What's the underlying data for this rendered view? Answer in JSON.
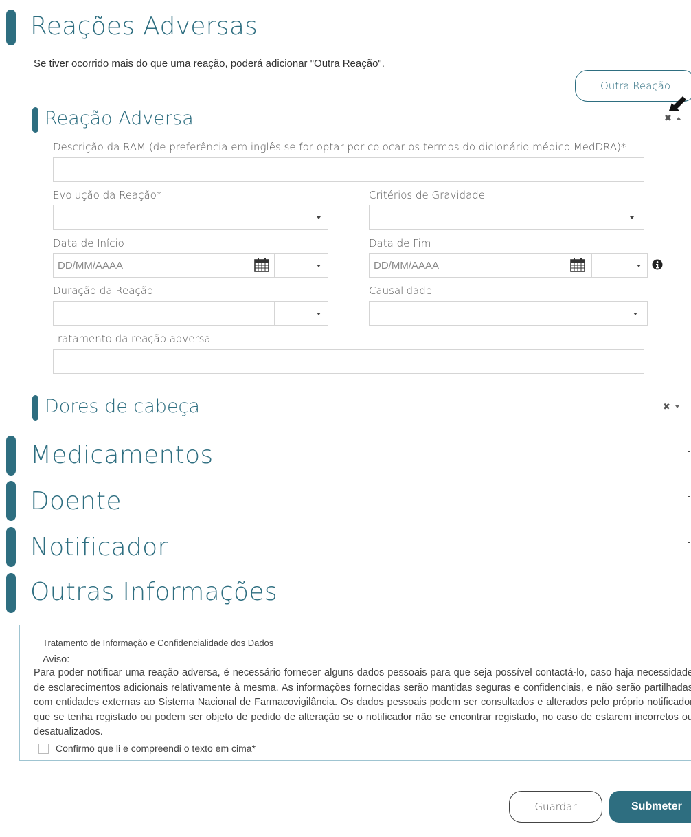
{
  "sections": {
    "reacoes_adversas": {
      "title": "Reações Adversas",
      "intro": "Se tiver ocorrido mais do que uma reação, poderá adicionar \"Outra Reação\".",
      "add_button": "Outra Reação"
    },
    "reacao_adversa": {
      "title": "Reação Adversa",
      "descricao_label": "Descrição da RAM (de preferência em inglês se for optar por colocar os termos do dicionário médico MedDRA)*",
      "descricao_value": "",
      "evolucao_label": "Evolução da Reação*",
      "evolucao_value": "",
      "criterios_label": "Critérios de Gravidade",
      "criterios_value": "",
      "data_inicio_label": "Data de Início",
      "data_inicio_placeholder": "DD/MM/AAAA",
      "data_fim_label": "Data de Fim",
      "data_fim_placeholder": "DD/MM/AAAA",
      "duracao_label": "Duração da Reação",
      "duracao_value": "",
      "causalidade_label": "Causalidade",
      "causalidade_value": "",
      "tratamento_label": "Tratamento da reação adversa",
      "tratamento_value": ""
    },
    "dores_de_cabeca": {
      "title": "Dores de cabeça"
    },
    "medicamentos": {
      "title": "Medicamentos"
    },
    "doente": {
      "title": "Doente"
    },
    "notificador": {
      "title": "Notificador"
    },
    "outras_informacoes": {
      "title": "Outras Informações"
    }
  },
  "privacy": {
    "link": "Tratamento de Informação e Confidencialidade dos Dados",
    "aviso": "Aviso:",
    "text": "Para poder notificar uma reação adversa, é necessário fornecer alguns dados pessoais para que seja possível contactá-lo, caso haja necessidade de esclarecimentos adicionais relativamente à mesma. As informações fornecidas serão mantidas seguras e confidenciais, e não serão partilhadas com entidades externas ao Sistema Nacional de Farmacovigilância. Os dados pessoais podem ser consultados e alterados pelo próprio notificador que se tenha registado ou podem ser objeto de pedido de alteração se o notificador não se encontrar registado, no caso de estarem incorretos ou desatualizados.",
    "checkbox_label": "Confirmo que li e compreendi o texto em cima*",
    "checked": false
  },
  "actions": {
    "save": "Guardar",
    "submit": "Submeter"
  },
  "colors": {
    "accent": "#2e6e80",
    "border": "#d5d5d5"
  }
}
